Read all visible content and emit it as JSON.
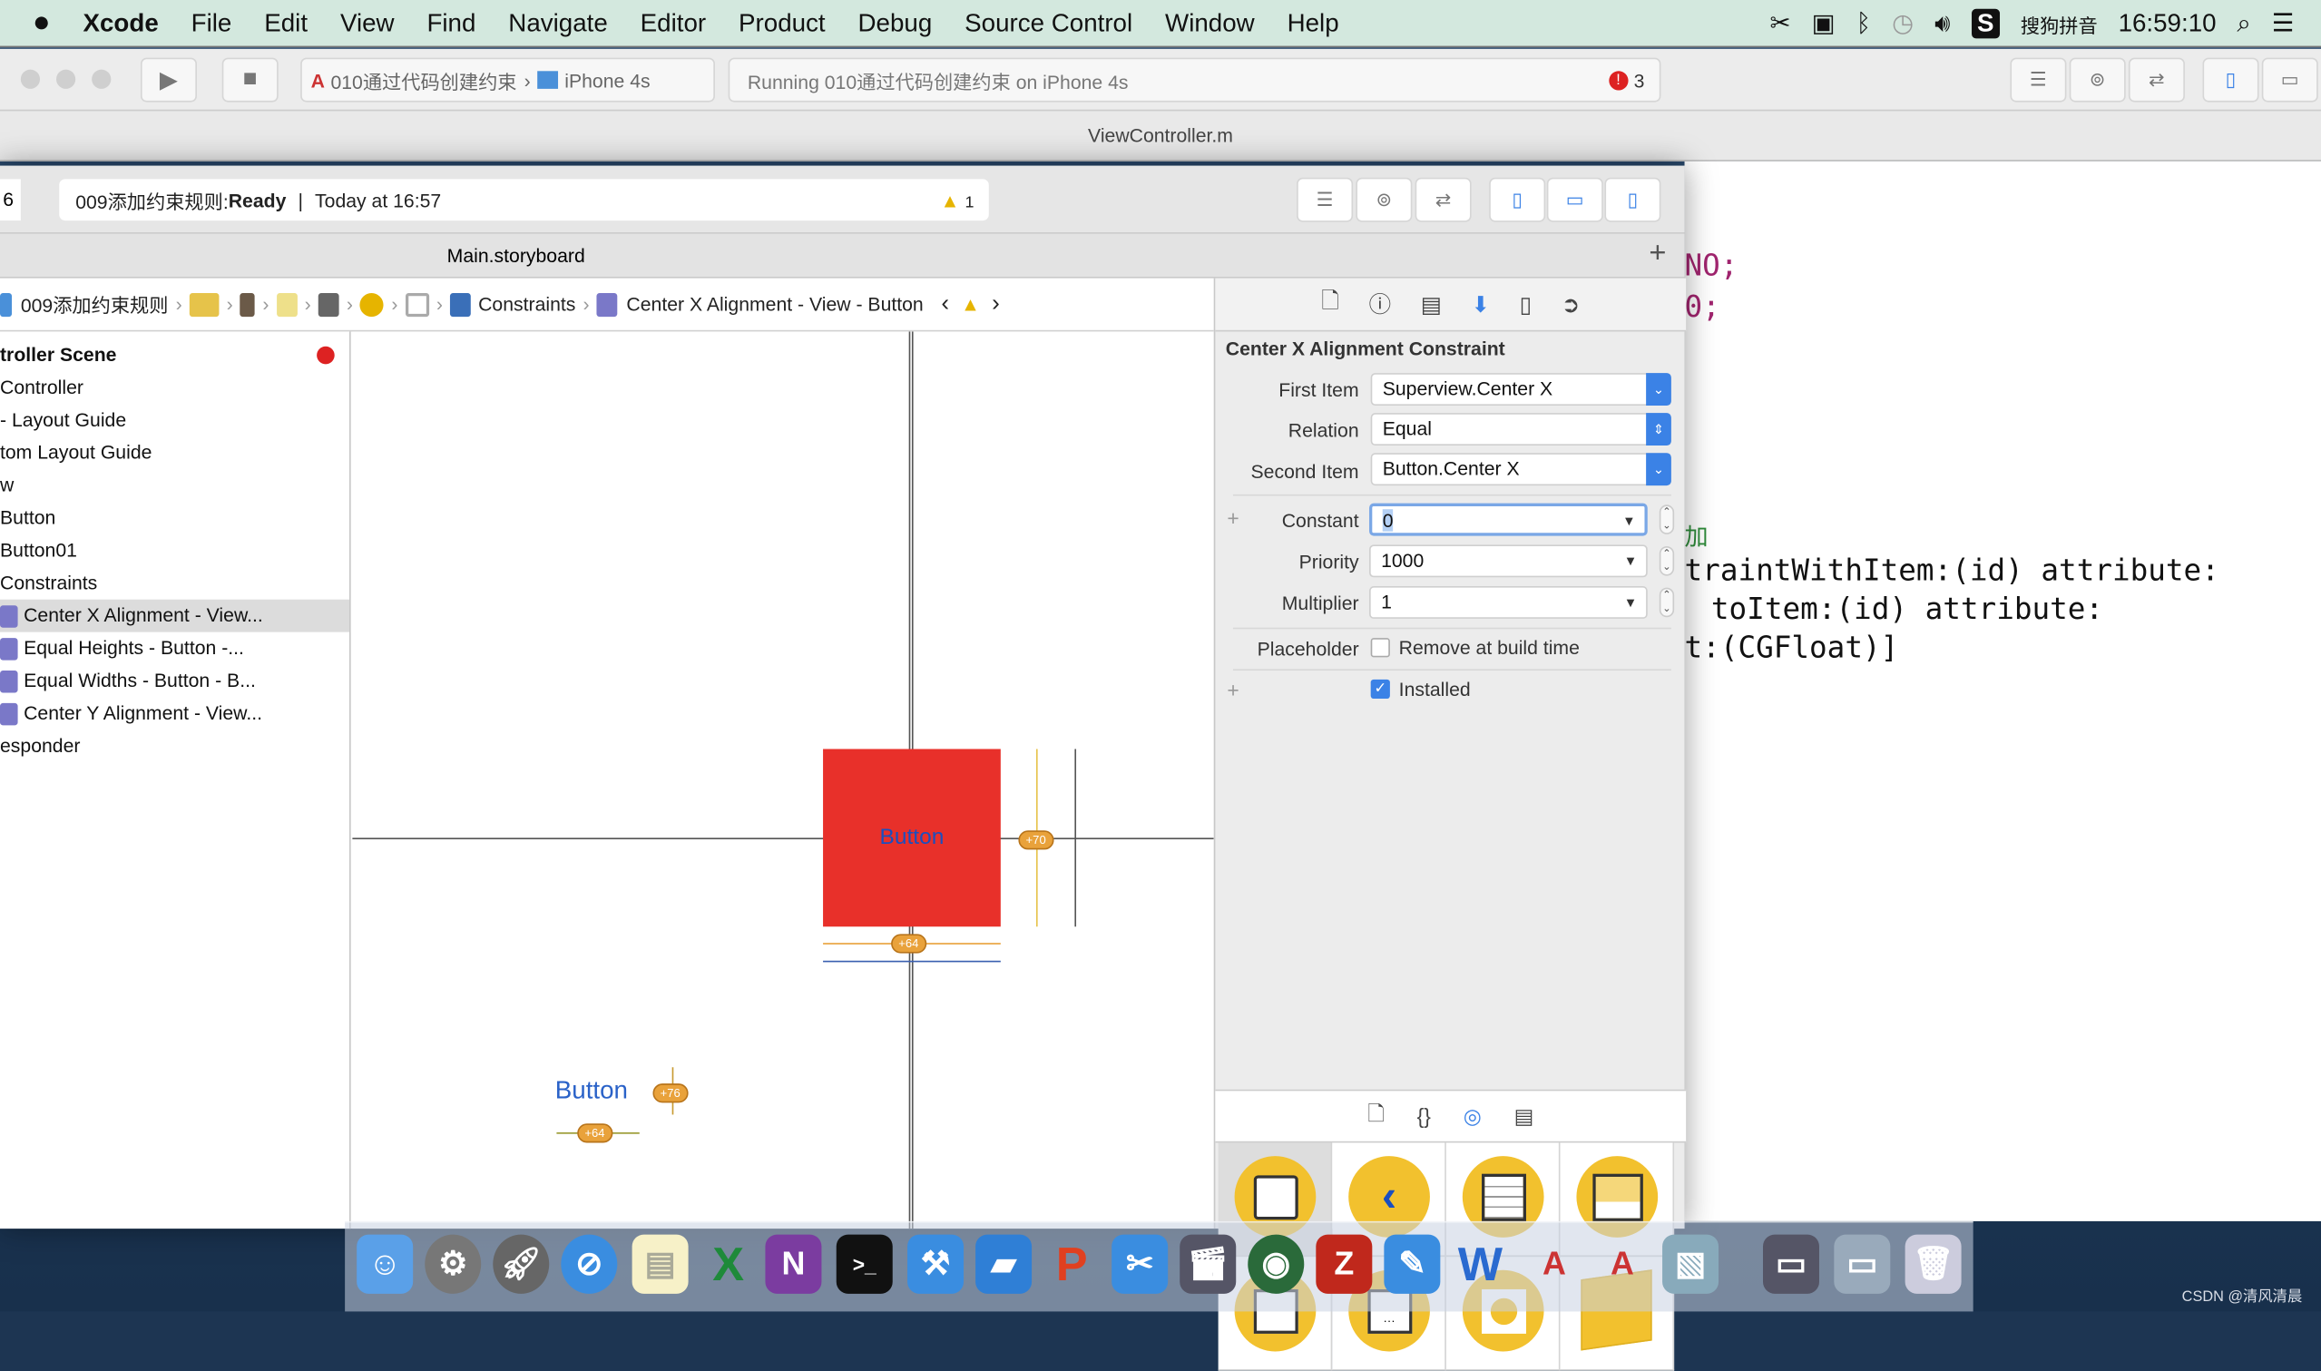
{
  "menubar": {
    "apple": "",
    "items": [
      "Xcode",
      "File",
      "Edit",
      "View",
      "Find",
      "Navigate",
      "Editor",
      "Product",
      "Debug",
      "Source Control",
      "Window",
      "Help"
    ],
    "input_method": "搜狗拼音",
    "clock": "16:59:10"
  },
  "toolbar": {
    "scheme": "010通过代码创建约束",
    "device": "iPhone 4s",
    "activity": "Running 010通过代码创建约束 on iPhone 4s",
    "error_count": "3"
  },
  "editor_tab": {
    "title": "ViewController.m"
  },
  "code": {
    "lines": [
      "NO;",
      "0;",
      "加",
      "traintWithItem:(id) attribute:",
      "toItem:(id) attribute:",
      "t:(CGFloat)]"
    ]
  },
  "window2": {
    "left_counter": "6",
    "status": {
      "project": "009添加约束规则: ",
      "state": "Ready",
      "sep": "|",
      "time": "Today at 16:57",
      "warning_count": "1"
    },
    "tab": "Main.storyboard",
    "jumpbar": {
      "project": "009添加约束规则",
      "constraints": "Constraints",
      "current": "Center X Alignment - View - Button"
    },
    "outline": {
      "scene": "troller Scene",
      "items": [
        "Controller",
        "Layout Guide",
        "tom Layout Guide",
        "w",
        "Button",
        "Button01",
        "Constraints"
      ],
      "constraints": [
        "Center X Alignment - View...",
        "Equal Heights - Button -...",
        "Equal Widths - Button - B...",
        "Center Y Alignment - View..."
      ],
      "responder": "esponder"
    },
    "canvas": {
      "button_title": "Button",
      "button2_title": "Button",
      "badges": [
        "+70",
        "+64",
        "+76",
        "+64"
      ]
    },
    "inspector": {
      "title": "Center X Alignment Constraint",
      "first_item_label": "First Item",
      "first_item": "Superview.Center X",
      "relation_label": "Relation",
      "relation": "Equal",
      "second_item_label": "Second Item",
      "second_item": "Button.Center X",
      "constant_label": "Constant",
      "constant": "0",
      "priority_label": "Priority",
      "priority": "1000",
      "multiplier_label": "Multiplier",
      "multiplier": "1",
      "placeholder_label": "Placeholder",
      "placeholder_option": "Remove at build time",
      "placeholder_checked": false,
      "installed_label": "Installed",
      "installed_checked": true
    }
  },
  "colors": {
    "accent": "#3b82e6",
    "button_red": "#e8302a",
    "library_yellow": "#f2c12e",
    "badge": "#e9a23b"
  },
  "watermark": "CSDN @清风清晨"
}
